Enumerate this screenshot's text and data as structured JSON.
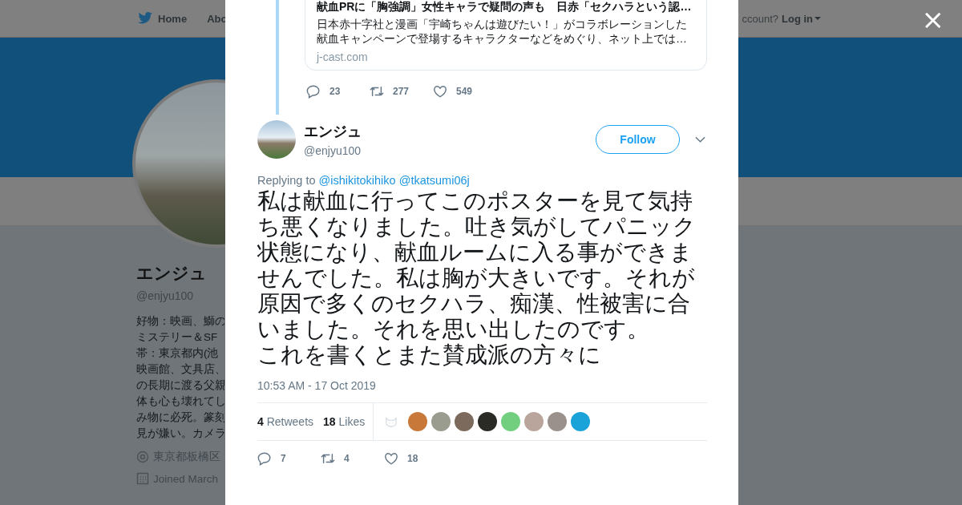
{
  "background_page": {
    "nav": {
      "items": [
        "Home",
        "Abo"
      ],
      "account_prompt": "ccount?",
      "login": "Log in"
    },
    "profile": {
      "name": "エンジュ",
      "handle": "@enjyu100",
      "bio_lines": [
        "好物：映画、鰤の",
        "ミステリー＆SF",
        "帯：東京都内(池",
        "映画館、文具店、",
        "の長期に渡る父親",
        "体も心も壊れてし",
        "み物に必死。篆刻",
        "見が嫌い。カメラ"
      ],
      "location": "東京都板橋区",
      "joined": "Joined March"
    }
  },
  "close_label": "×",
  "quoted_tweet": {
    "card": {
      "title": "献血PRに「胸強調」女性キャラで疑問の声も　日赤「セクハラという認…",
      "description": "日本赤十字社と漫画「宇崎ちゃんは遊びたい！」がコラボレーションした献血キャンペーンで登場するキャラクターなどをめぐり、ネット上では…",
      "domain": "j-cast.com"
    },
    "actions": [
      {
        "kind": "reply",
        "count": "23"
      },
      {
        "kind": "retweet",
        "count": "277"
      },
      {
        "kind": "like",
        "count": "549"
      }
    ]
  },
  "tweet": {
    "author_name": "エンジュ",
    "author_handle": "@enjyu100",
    "follow_label": "Follow",
    "replying_label": "Replying to",
    "replying_to": [
      "@ishikitokihiko",
      "@tkatsumi06j"
    ],
    "text_paragraphs": [
      "私は献血に行ってこのポスターを見て気持ち悪くなりました。吐き気がしてパニック状態になり、献血ルームに入る事ができませんでした。私は胸が大きいです。それが原因で多くのセクハラ、痴漢、性被害に合いました。それを思い出したのです。",
      "これを書くとまた賛成派の方々に"
    ],
    "timestamp": "10:53 AM - 17 Oct 2019",
    "stats": [
      {
        "count": "4",
        "label": "Retweets"
      },
      {
        "count": "18",
        "label": "Likes"
      }
    ],
    "actions": [
      {
        "kind": "reply",
        "count": "7"
      },
      {
        "kind": "retweet",
        "count": "4"
      },
      {
        "kind": "like",
        "count": "18"
      }
    ]
  }
}
